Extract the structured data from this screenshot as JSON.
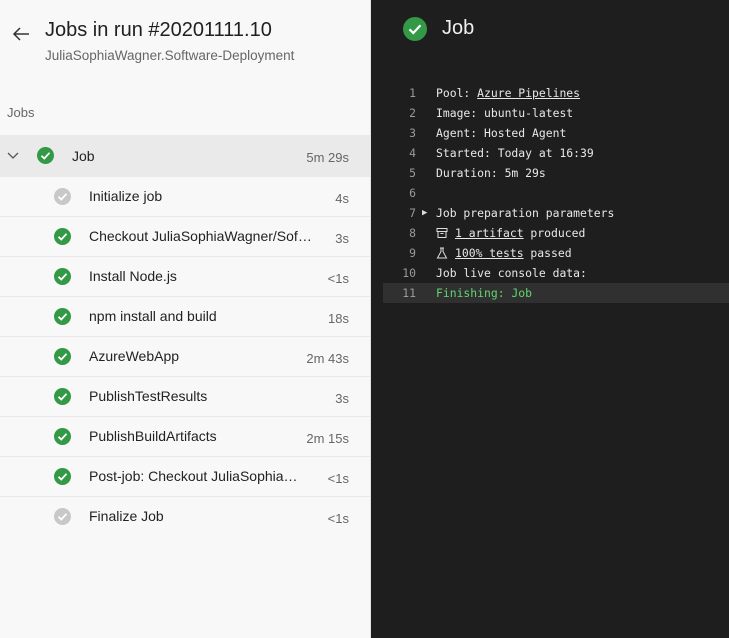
{
  "header": {
    "title": "Jobs in run #20201111.10",
    "subtitle": "JuliaSophiaWagner.Software-Deployment"
  },
  "jobs_section_label": "Jobs",
  "job": {
    "name": "Job",
    "duration": "5m 29s"
  },
  "steps": [
    {
      "name": "Initialize job",
      "duration": "4s",
      "status": "skipped"
    },
    {
      "name": "Checkout JuliaSophiaWagner/Soft…",
      "duration": "3s",
      "status": "succeeded"
    },
    {
      "name": "Install Node.js",
      "duration": "<1s",
      "status": "succeeded"
    },
    {
      "name": "npm install and build",
      "duration": "18s",
      "status": "succeeded"
    },
    {
      "name": "AzureWebApp",
      "duration": "2m 43s",
      "status": "succeeded"
    },
    {
      "name": "PublishTestResults",
      "duration": "3s",
      "status": "succeeded"
    },
    {
      "name": "PublishBuildArtifacts",
      "duration": "2m 15s",
      "status": "succeeded"
    },
    {
      "name": "Post-job: Checkout JuliaSophia…",
      "duration": "<1s",
      "status": "succeeded"
    },
    {
      "name": "Finalize Job",
      "duration": "<1s",
      "status": "skipped"
    }
  ],
  "log": {
    "title": "Job",
    "lines": {
      "n1": "1",
      "n2": "2",
      "n3": "3",
      "n4": "4",
      "n5": "5",
      "n6": "6",
      "n7": "7",
      "n8": "8",
      "n9": "9",
      "n10": "10",
      "n11": "11",
      "pool_label": "Pool: ",
      "pool_link": "Azure Pipelines",
      "image": "Image: ubuntu-latest",
      "agent": "Agent: Hosted Agent",
      "started": "Started: Today at 16:39",
      "duration": "Duration: 5m 29s",
      "job_prep": "Job preparation parameters",
      "artifact_link": "1 artifact",
      "artifact_suffix": " produced",
      "tests_link": "100% tests",
      "tests_suffix": " passed",
      "console": "Job live console data:",
      "finishing": "Finishing: Job"
    }
  },
  "colors": {
    "success": "#339947",
    "skipped": "#c8c8c8",
    "log_bg": "#1e1e1e",
    "finishing": "#62d572"
  }
}
